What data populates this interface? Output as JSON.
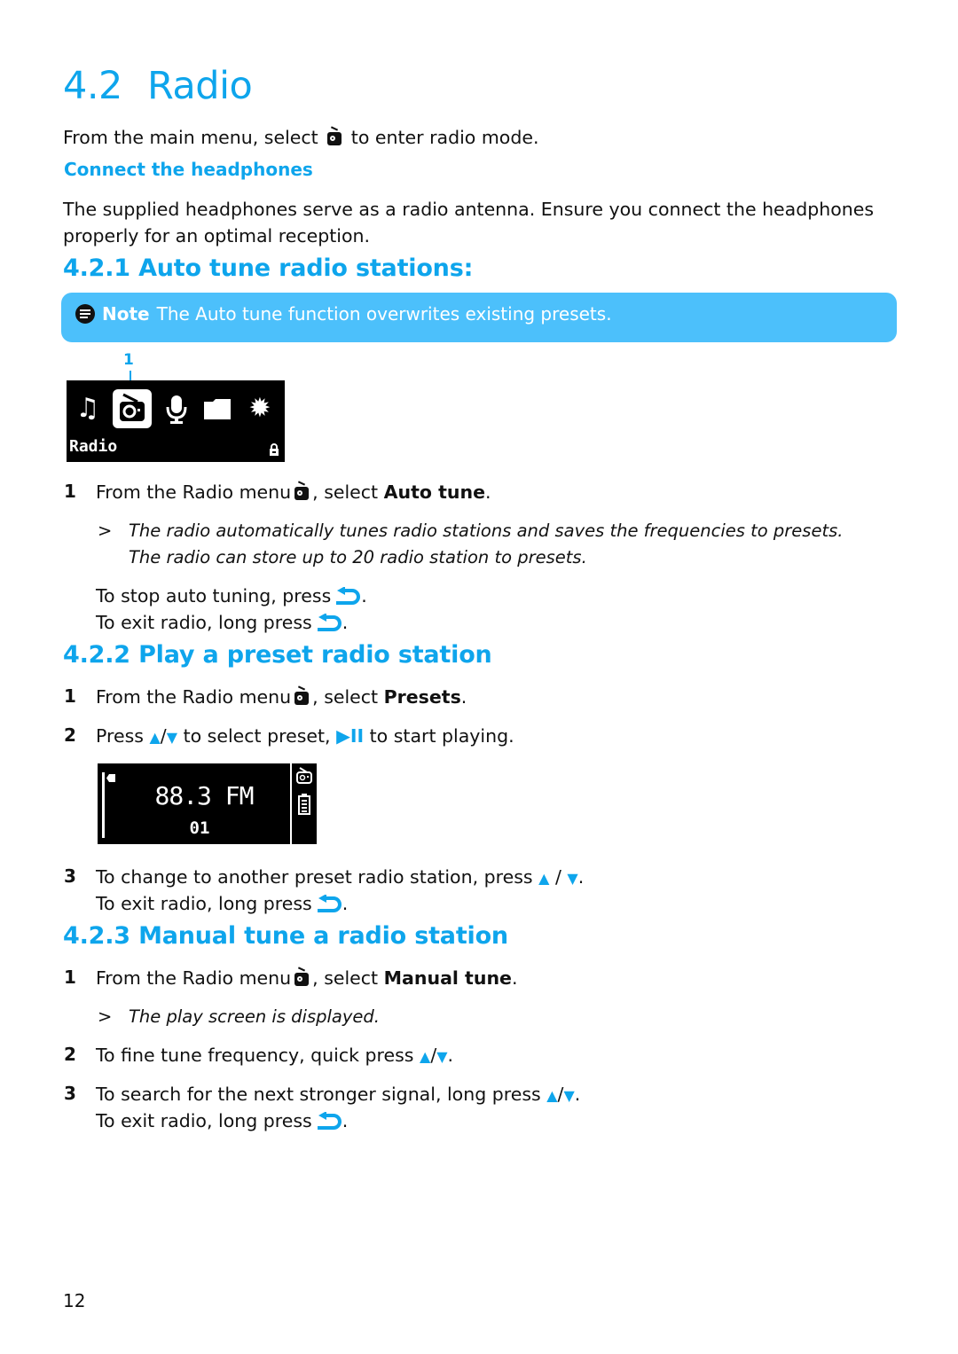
{
  "title": {
    "number": "4.2",
    "text": "Radio"
  },
  "intro": {
    "before": "From the main menu, select",
    "icon": "radio-icon",
    "after": "to enter radio mode."
  },
  "connect": {
    "heading": "Connect the headphones",
    "line1": "The supplied headphones serve as a radio antenna. Ensure you connect the headphones",
    "line2": "properly for an optimal reception."
  },
  "section1": {
    "heading": "4.2.1 Auto tune radio stations:",
    "note": {
      "icon": "note-icon",
      "label": "Note",
      "text": "The Auto tune function overwrites existing presets."
    },
    "screen": {
      "callout": "1",
      "icons": [
        "music-icon",
        "radio-icon",
        "microphone-icon",
        "folder-icon",
        "settings-icon"
      ],
      "selected": "radio-icon",
      "label": "Radio",
      "status_icon": "lock-icon"
    },
    "step1": {
      "num": "1",
      "before": "From the Radio menu",
      "mid": ", select",
      "bold": "Auto tune",
      "end": "."
    },
    "result1": {
      "marker": ">",
      "line1": "The radio automatically tunes radio stations and saves the frequencies to presets.",
      "line2": "The radio can store up to 20 radio station to presets."
    },
    "stop": "To stop auto tuning, press",
    "exit": "To exit radio, long press"
  },
  "section2": {
    "heading": "4.2.2 Play a preset radio station",
    "step1": {
      "num": "1",
      "before": "From the Radio menu",
      "mid": ", select",
      "bold": "Presets",
      "end": "."
    },
    "step2": {
      "num": "2",
      "before": "Press",
      "up": "▲",
      "slash": "/",
      "down": "▼",
      "mid": "to select preset,",
      "play": "▶II",
      "after": "to start playing."
    },
    "screen": {
      "frequency": "88.3 FM",
      "preset": "01",
      "icons": [
        "radio-icon",
        "battery-icon"
      ]
    },
    "step3": {
      "num": "3",
      "text": "To change to another preset radio station, press",
      "up": "▲",
      "slash": " / ",
      "down": "▼",
      "end": "."
    },
    "exit": "To exit radio, long press"
  },
  "section3": {
    "heading": "4.2.3 Manual tune a radio station",
    "step1": {
      "num": "1",
      "before": "From the Radio menu",
      "mid": ", select",
      "bold": "Manual tune",
      "end": "."
    },
    "result1": {
      "marker": ">",
      "text": "The play screen is displayed."
    },
    "step2": {
      "num": "2",
      "text": "To fine tune frequency, quick press",
      "up": "▲",
      "slash": "/",
      "down": "▼",
      "end": "."
    },
    "step3": {
      "num": "3",
      "text": "To search for the next stronger signal, long press",
      "up": "▲",
      "slash": "/",
      "down": "▼",
      "end": "."
    },
    "exit": "To exit radio, long press"
  },
  "colors": {
    "accent": "#0ea5ec",
    "note_bg": "#4cc0fb"
  },
  "page_number": "12"
}
